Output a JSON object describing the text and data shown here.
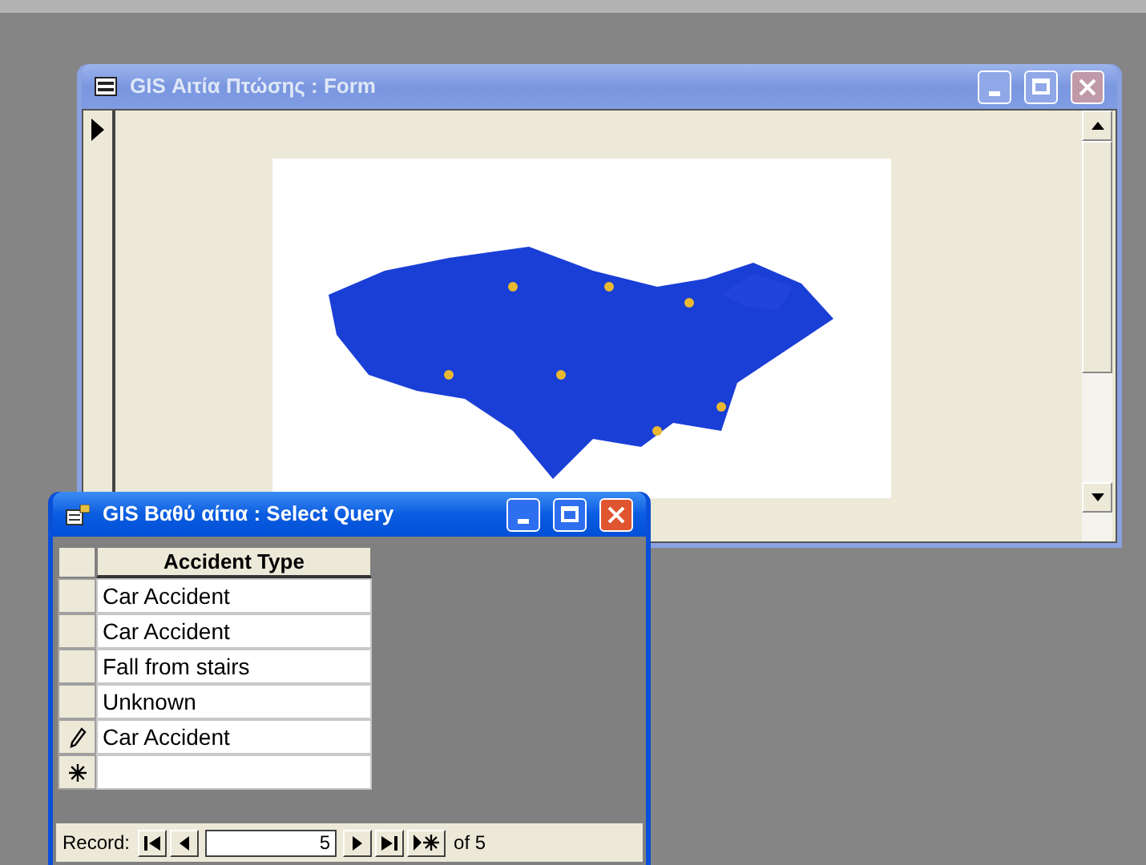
{
  "form_window": {
    "title": "GIS Αιτία Πτώσης : Form",
    "active": false,
    "record_selector": {
      "current": true
    }
  },
  "query_window": {
    "title": "GIS Βαθύ αίτια : Select Query",
    "active": true,
    "table": {
      "columns": [
        "Accident Type"
      ],
      "rows": [
        {
          "kind": "record",
          "cells": [
            "Car Accident"
          ],
          "editing": false
        },
        {
          "kind": "record",
          "cells": [
            "Car Accident"
          ],
          "editing": false
        },
        {
          "kind": "record",
          "cells": [
            "Fall from stairs"
          ],
          "editing": false
        },
        {
          "kind": "record",
          "cells": [
            "Unknown"
          ],
          "editing": false
        },
        {
          "kind": "record",
          "cells": [
            "Car Accident"
          ],
          "editing": true
        },
        {
          "kind": "new",
          "cells": [
            ""
          ],
          "editing": false
        }
      ]
    },
    "navigation": {
      "label": "Record:",
      "current": "5",
      "total": "of 5"
    }
  }
}
